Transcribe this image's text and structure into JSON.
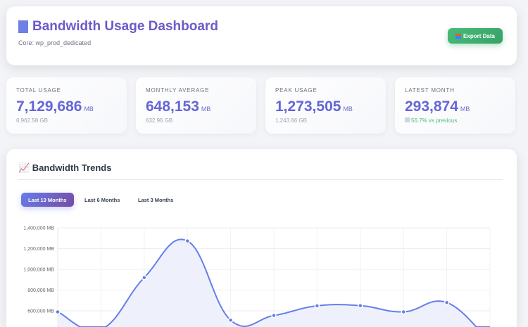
{
  "header": {
    "title_icon": "bar-chart-icon",
    "title": "Bandwidth Usage Dashboard",
    "subtitle": "Core: wp_prod_dedicated",
    "export_icon": "inbox-tray-icon",
    "export_label": "Export Data"
  },
  "stats": [
    {
      "label": "TOTAL USAGE",
      "value": "7,129,686",
      "unit": "MB",
      "sub": "6,962.58 GB"
    },
    {
      "label": "MONTHLY AVERAGE",
      "value": "648,153",
      "unit": "MB",
      "sub": "632.96 GB"
    },
    {
      "label": "PEAK USAGE",
      "value": "1,273,505",
      "unit": "MB",
      "sub": "1,243.66 GB"
    },
    {
      "label": "LATEST MONTH",
      "value": "293,874",
      "unit": "MB",
      "sub": "56.7% vs previous",
      "sub_icon": "chart-decreasing-icon"
    }
  ],
  "trends": {
    "title": "📈 Bandwidth Trends",
    "tabs": [
      "Last 13 Months",
      "Last 6 Months",
      "Last 3 Months"
    ],
    "active_tab": 0
  },
  "chart_data": {
    "type": "area",
    "ylim": [
      0,
      1400000
    ],
    "yticks": [
      {
        "v": 600000,
        "label": "600,000 MB"
      },
      {
        "v": 800000,
        "label": "800,000 MB"
      },
      {
        "v": 1000000,
        "label": "1,000,000 MB"
      },
      {
        "v": 1200000,
        "label": "1,200,000 MB"
      },
      {
        "v": 1400000,
        "label": "1,400,000 MB"
      }
    ],
    "values": [
      590000,
      421000,
      920000,
      1273505,
      510000,
      555000,
      648000,
      650000,
      590000,
      680000,
      293874
    ],
    "grid": true,
    "line_color": "#667eea",
    "fill_color": "#eef1fc"
  }
}
